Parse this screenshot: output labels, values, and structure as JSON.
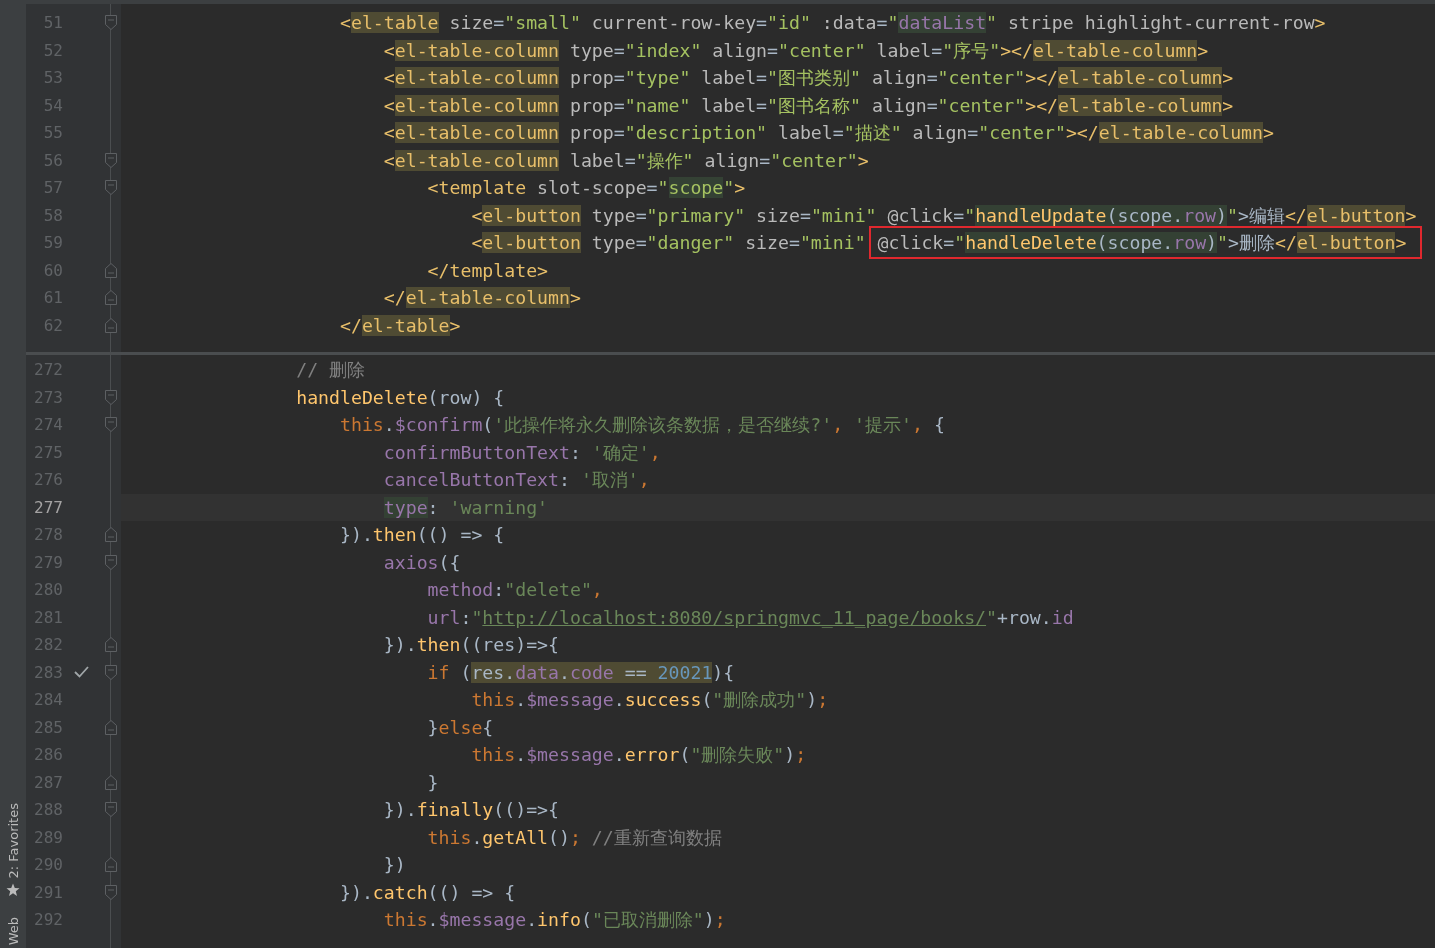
{
  "sidebar": {
    "items": [
      {
        "label": "2: Favorites",
        "kind": "starred"
      },
      {
        "label": "Web",
        "kind": "plain"
      }
    ]
  },
  "panes": [
    {
      "lines": [
        {
          "number": "51",
          "kind": "fold-start",
          "current": false,
          "check": false,
          "tokens": [
            {
              "text": "                    <",
              "kind": "tag"
            },
            {
              "text": "el-table",
              "kind": "tag_usage"
            },
            {
              "text": " size",
              "kind": "at"
            },
            {
              "text": "=",
              "kind": "p"
            },
            {
              "text": "\"small\"",
              "kind": "av"
            },
            {
              "text": " current-row-key",
              "kind": "at"
            },
            {
              "text": "=",
              "kind": "p"
            },
            {
              "text": "\"id\"",
              "kind": "av"
            },
            {
              "text": " :data",
              "kind": "at"
            },
            {
              "text": "=",
              "kind": "p"
            },
            {
              "text": "\"",
              "kind": "av"
            },
            {
              "text": "dataList",
              "kind": "pr_match"
            },
            {
              "text": "\"",
              "kind": "av"
            },
            {
              "text": " stripe highlight-current-row",
              "kind": "at"
            },
            {
              "text": ">",
              "kind": "tag"
            }
          ]
        },
        {
          "number": "52",
          "kind": "plain",
          "current": false,
          "check": false,
          "tokens": [
            {
              "text": "                        <",
              "kind": "tag"
            },
            {
              "text": "el-table-column",
              "kind": "tag_usage"
            },
            {
              "text": " type",
              "kind": "at"
            },
            {
              "text": "=",
              "kind": "p"
            },
            {
              "text": "\"index\"",
              "kind": "av"
            },
            {
              "text": " align",
              "kind": "at"
            },
            {
              "text": "=",
              "kind": "p"
            },
            {
              "text": "\"center\"",
              "kind": "av"
            },
            {
              "text": " label",
              "kind": "at"
            },
            {
              "text": "=",
              "kind": "p"
            },
            {
              "text": "\"序号\"",
              "kind": "av"
            },
            {
              "text": "></",
              "kind": "tag"
            },
            {
              "text": "el-table-column",
              "kind": "tag_usage"
            },
            {
              "text": ">",
              "kind": "tag"
            }
          ]
        },
        {
          "number": "53",
          "kind": "plain",
          "current": false,
          "check": false,
          "tokens": [
            {
              "text": "                        <",
              "kind": "tag"
            },
            {
              "text": "el-table-column",
              "kind": "tag_usage"
            },
            {
              "text": " prop",
              "kind": "at"
            },
            {
              "text": "=",
              "kind": "p"
            },
            {
              "text": "\"type\"",
              "kind": "av"
            },
            {
              "text": " label",
              "kind": "at"
            },
            {
              "text": "=",
              "kind": "p"
            },
            {
              "text": "\"图书类别\"",
              "kind": "av"
            },
            {
              "text": " align",
              "kind": "at"
            },
            {
              "text": "=",
              "kind": "p"
            },
            {
              "text": "\"center\"",
              "kind": "av"
            },
            {
              "text": "></",
              "kind": "tag"
            },
            {
              "text": "el-table-column",
              "kind": "tag_usage"
            },
            {
              "text": ">",
              "kind": "tag"
            }
          ]
        },
        {
          "number": "54",
          "kind": "plain",
          "current": false,
          "check": false,
          "tokens": [
            {
              "text": "                        <",
              "kind": "tag"
            },
            {
              "text": "el-table-column",
              "kind": "tag_usage"
            },
            {
              "text": " prop",
              "kind": "at"
            },
            {
              "text": "=",
              "kind": "p"
            },
            {
              "text": "\"name\"",
              "kind": "av"
            },
            {
              "text": " label",
              "kind": "at"
            },
            {
              "text": "=",
              "kind": "p"
            },
            {
              "text": "\"图书名称\"",
              "kind": "av"
            },
            {
              "text": " align",
              "kind": "at"
            },
            {
              "text": "=",
              "kind": "p"
            },
            {
              "text": "\"center\"",
              "kind": "av"
            },
            {
              "text": "></",
              "kind": "tag"
            },
            {
              "text": "el-table-column",
              "kind": "tag_usage"
            },
            {
              "text": ">",
              "kind": "tag"
            }
          ]
        },
        {
          "number": "55",
          "kind": "plain",
          "current": false,
          "check": false,
          "tokens": [
            {
              "text": "                        <",
              "kind": "tag"
            },
            {
              "text": "el-table-column",
              "kind": "tag_usage"
            },
            {
              "text": " prop",
              "kind": "at"
            },
            {
              "text": "=",
              "kind": "p"
            },
            {
              "text": "\"description\"",
              "kind": "av"
            },
            {
              "text": " label",
              "kind": "at"
            },
            {
              "text": "=",
              "kind": "p"
            },
            {
              "text": "\"描述\"",
              "kind": "av"
            },
            {
              "text": " align",
              "kind": "at"
            },
            {
              "text": "=",
              "kind": "p"
            },
            {
              "text": "\"center\"",
              "kind": "av"
            },
            {
              "text": "></",
              "kind": "tag"
            },
            {
              "text": "el-table-column",
              "kind": "tag_usage"
            },
            {
              "text": ">",
              "kind": "tag"
            }
          ]
        },
        {
          "number": "56",
          "kind": "fold-start",
          "current": false,
          "check": false,
          "tokens": [
            {
              "text": "                        <",
              "kind": "tag"
            },
            {
              "text": "el-table-column",
              "kind": "tag_usage"
            },
            {
              "text": " label",
              "kind": "at"
            },
            {
              "text": "=",
              "kind": "p"
            },
            {
              "text": "\"操作\"",
              "kind": "av"
            },
            {
              "text": " align",
              "kind": "at"
            },
            {
              "text": "=",
              "kind": "p"
            },
            {
              "text": "\"center\"",
              "kind": "av"
            },
            {
              "text": ">",
              "kind": "tag"
            }
          ]
        },
        {
          "number": "57",
          "kind": "fold-start",
          "current": false,
          "check": false,
          "tokens": [
            {
              "text": "                            <template",
              "kind": "tag"
            },
            {
              "text": " slot-scope",
              "kind": "at"
            },
            {
              "text": "=",
              "kind": "p"
            },
            {
              "text": "\"",
              "kind": "av"
            },
            {
              "text": "scope",
              "kind": "av_match"
            },
            {
              "text": "\"",
              "kind": "av"
            },
            {
              "text": ">",
              "kind": "tag"
            }
          ]
        },
        {
          "number": "58",
          "kind": "plain",
          "current": false,
          "check": false,
          "tokens": [
            {
              "text": "                                <",
              "kind": "tag"
            },
            {
              "text": "el-button",
              "kind": "tag_usage"
            },
            {
              "text": " type",
              "kind": "at"
            },
            {
              "text": "=",
              "kind": "p"
            },
            {
              "text": "\"primary\"",
              "kind": "av"
            },
            {
              "text": " size",
              "kind": "at"
            },
            {
              "text": "=",
              "kind": "p"
            },
            {
              "text": "\"mini\"",
              "kind": "av"
            },
            {
              "text": " @click",
              "kind": "at"
            },
            {
              "text": "=",
              "kind": "p"
            },
            {
              "text": "\"",
              "kind": "av"
            },
            {
              "text": "handleUpdate",
              "kind": "fn_match"
            },
            {
              "text": "(scope.",
              "kind": "p_match"
            },
            {
              "text": "row",
              "kind": "pr_match"
            },
            {
              "text": ")",
              "kind": "p_match"
            },
            {
              "text": "\"",
              "kind": "av"
            },
            {
              "text": ">编辑",
              "kind": "p"
            },
            {
              "text": "</",
              "kind": "tag"
            },
            {
              "text": "el-button",
              "kind": "tag_usage"
            },
            {
              "text": ">",
              "kind": "tag"
            }
          ]
        },
        {
          "number": "59",
          "kind": "plain",
          "current": false,
          "check": false,
          "tokens": [
            {
              "text": "                                <",
              "kind": "tag"
            },
            {
              "text": "el-button",
              "kind": "tag_usage"
            },
            {
              "text": " type",
              "kind": "at"
            },
            {
              "text": "=",
              "kind": "p"
            },
            {
              "text": "\"danger\"",
              "kind": "av"
            },
            {
              "text": " size",
              "kind": "at"
            },
            {
              "text": "=",
              "kind": "p"
            },
            {
              "text": "\"mini\" ",
              "kind": "av"
            }
          ],
          "framed_tokens": [
            {
              "text": "@click",
              "kind": "at"
            },
            {
              "text": "=",
              "kind": "p"
            },
            {
              "text": "\"",
              "kind": "av"
            },
            {
              "text": "handleDelete",
              "kind": "fn_match"
            },
            {
              "text": "(scope.",
              "kind": "p_match"
            },
            {
              "text": "row",
              "kind": "pr_match"
            },
            {
              "text": ")",
              "kind": "p_match"
            },
            {
              "text": "\"",
              "kind": "av"
            },
            {
              "text": ">删除",
              "kind": "p"
            },
            {
              "text": "</",
              "kind": "tag"
            },
            {
              "text": "el-button",
              "kind": "tag_usage"
            },
            {
              "text": ">",
              "kind": "tag"
            }
          ]
        },
        {
          "number": "60",
          "kind": "fold-end",
          "current": false,
          "check": false,
          "tokens": [
            {
              "text": "                            </template>",
              "kind": "tag"
            }
          ]
        },
        {
          "number": "61",
          "kind": "fold-end",
          "current": false,
          "check": false,
          "tokens": [
            {
              "text": "                        </",
              "kind": "tag"
            },
            {
              "text": "el-table-column",
              "kind": "tag_usage"
            },
            {
              "text": ">",
              "kind": "tag"
            }
          ]
        },
        {
          "number": "62",
          "kind": "fold-end",
          "current": false,
          "check": false,
          "tokens": [
            {
              "text": "                    </",
              "kind": "tag"
            },
            {
              "text": "el-table",
              "kind": "tag_usage"
            },
            {
              "text": ">",
              "kind": "tag"
            }
          ]
        }
      ]
    },
    {
      "lines": [
        {
          "number": "272",
          "kind": "plain",
          "current": false,
          "check": false,
          "tokens": [
            {
              "text": "                // 删除",
              "kind": "c"
            }
          ]
        },
        {
          "number": "273",
          "kind": "fold-start",
          "current": false,
          "check": false,
          "tokens": [
            {
              "text": "                handleDelete",
              "kind": "fn"
            },
            {
              "text": "(row) {",
              "kind": "p"
            }
          ]
        },
        {
          "number": "274",
          "kind": "fold-start",
          "current": false,
          "check": false,
          "tokens": [
            {
              "text": "                    this",
              "kind": "kw"
            },
            {
              "text": ".",
              "kind": "p"
            },
            {
              "text": "$confirm",
              "kind": "pr"
            },
            {
              "text": "(",
              "kind": "p"
            },
            {
              "text": "'此操作将永久删除该条数据，是否继续?'",
              "kind": "s"
            },
            {
              "text": ", ",
              "kind": "kw"
            },
            {
              "text": "'提示'",
              "kind": "s"
            },
            {
              "text": ", ",
              "kind": "kw"
            },
            {
              "text": "{",
              "kind": "p"
            }
          ]
        },
        {
          "number": "275",
          "kind": "plain",
          "current": false,
          "check": false,
          "tokens": [
            {
              "text": "                        confirmButtonText",
              "kind": "pr"
            },
            {
              "text": ": ",
              "kind": "p"
            },
            {
              "text": "'确定'",
              "kind": "s"
            },
            {
              "text": ",",
              "kind": "kw"
            }
          ]
        },
        {
          "number": "276",
          "kind": "plain",
          "current": false,
          "check": false,
          "tokens": [
            {
              "text": "                        cancelButtonText",
              "kind": "pr"
            },
            {
              "text": ": ",
              "kind": "p"
            },
            {
              "text": "'取消'",
              "kind": "s"
            },
            {
              "text": ",",
              "kind": "kw"
            }
          ]
        },
        {
          "number": "277",
          "kind": "plain",
          "current": true,
          "check": false,
          "tokens": [
            {
              "text": "                        type",
              "kind": "pr_match"
            },
            {
              "text": ": ",
              "kind": "p"
            },
            {
              "text": "'warning'",
              "kind": "s"
            }
          ]
        },
        {
          "number": "278",
          "kind": "fold-end",
          "current": false,
          "check": false,
          "tokens": [
            {
              "text": "                    }).",
              "kind": "p"
            },
            {
              "text": "then",
              "kind": "fn"
            },
            {
              "text": "(() => {",
              "kind": "p"
            }
          ]
        },
        {
          "number": "279",
          "kind": "fold-start",
          "current": false,
          "check": false,
          "tokens": [
            {
              "text": "                        axios",
              "kind": "pr"
            },
            {
              "text": "({",
              "kind": "p"
            }
          ]
        },
        {
          "number": "280",
          "kind": "plain",
          "current": false,
          "check": false,
          "tokens": [
            {
              "text": "                            method",
              "kind": "pr"
            },
            {
              "text": ":",
              "kind": "p"
            },
            {
              "text": "\"delete\"",
              "kind": "s"
            },
            {
              "text": ",",
              "kind": "kw"
            }
          ]
        },
        {
          "number": "281",
          "kind": "plain",
          "current": false,
          "check": false,
          "tokens": [
            {
              "text": "                            url",
              "kind": "pr"
            },
            {
              "text": ":",
              "kind": "p"
            },
            {
              "text": "\"",
              "kind": "s"
            },
            {
              "text": "http://localhost:8080/springmvc_11_page/books/",
              "kind": "u"
            },
            {
              "text": "\"",
              "kind": "s"
            },
            {
              "text": "+row.",
              "kind": "p"
            },
            {
              "text": "id",
              "kind": "pr"
            }
          ]
        },
        {
          "number": "282",
          "kind": "fold-end",
          "current": false,
          "check": false,
          "tokens": [
            {
              "text": "                        }).",
              "kind": "p"
            },
            {
              "text": "then",
              "kind": "fn"
            },
            {
              "text": "((res)=>{",
              "kind": "p"
            }
          ]
        },
        {
          "number": "283",
          "kind": "fold-start",
          "current": false,
          "check": true,
          "tokens": [
            {
              "text": "                            if",
              "kind": "kw"
            },
            {
              "text": " (",
              "kind": "p"
            },
            {
              "text": "res.",
              "kind": "p_usage"
            },
            {
              "text": "data",
              "kind": "pr_usage"
            },
            {
              "text": ".",
              "kind": "p_usage"
            },
            {
              "text": "code",
              "kind": "pr_usage"
            },
            {
              "text": " == ",
              "kind": "p_usage"
            },
            {
              "text": "20021",
              "kind": "n_usage"
            },
            {
              "text": "){",
              "kind": "p"
            }
          ]
        },
        {
          "number": "284",
          "kind": "plain",
          "current": false,
          "check": false,
          "tokens": [
            {
              "text": "                                this",
              "kind": "kw"
            },
            {
              "text": ".",
              "kind": "p"
            },
            {
              "text": "$message",
              "kind": "pr"
            },
            {
              "text": ".",
              "kind": "p"
            },
            {
              "text": "success",
              "kind": "fn"
            },
            {
              "text": "(",
              "kind": "p"
            },
            {
              "text": "\"删除成功\"",
              "kind": "s"
            },
            {
              "text": ")",
              "kind": "p"
            },
            {
              "text": ";",
              "kind": "kw"
            }
          ]
        },
        {
          "number": "285",
          "kind": "fold-end",
          "current": false,
          "check": false,
          "tokens": [
            {
              "text": "                            }",
              "kind": "p"
            },
            {
              "text": "else",
              "kind": "kw"
            },
            {
              "text": "{",
              "kind": "p"
            }
          ]
        },
        {
          "number": "286",
          "kind": "plain",
          "current": false,
          "check": false,
          "tokens": [
            {
              "text": "                                this",
              "kind": "kw"
            },
            {
              "text": ".",
              "kind": "p"
            },
            {
              "text": "$message",
              "kind": "pr"
            },
            {
              "text": ".",
              "kind": "p"
            },
            {
              "text": "error",
              "kind": "fn"
            },
            {
              "text": "(",
              "kind": "p"
            },
            {
              "text": "\"删除失败\"",
              "kind": "s"
            },
            {
              "text": ")",
              "kind": "p"
            },
            {
              "text": ";",
              "kind": "kw"
            }
          ]
        },
        {
          "number": "287",
          "kind": "fold-end",
          "current": false,
          "check": false,
          "tokens": [
            {
              "text": "                            }",
              "kind": "p"
            }
          ]
        },
        {
          "number": "288",
          "kind": "fold-start",
          "current": false,
          "check": false,
          "tokens": [
            {
              "text": "                        }).",
              "kind": "p"
            },
            {
              "text": "finally",
              "kind": "fn"
            },
            {
              "text": "(()=>{",
              "kind": "p"
            }
          ]
        },
        {
          "number": "289",
          "kind": "plain",
          "current": false,
          "check": false,
          "tokens": [
            {
              "text": "                            this",
              "kind": "kw"
            },
            {
              "text": ".",
              "kind": "p"
            },
            {
              "text": "getAll",
              "kind": "fn"
            },
            {
              "text": "()",
              "kind": "p"
            },
            {
              "text": ";",
              "kind": "kw"
            },
            {
              "text": " //重新查询数据",
              "kind": "c"
            }
          ]
        },
        {
          "number": "290",
          "kind": "fold-end",
          "current": false,
          "check": false,
          "tokens": [
            {
              "text": "                        })",
              "kind": "p"
            }
          ]
        },
        {
          "number": "291",
          "kind": "fold-start",
          "current": false,
          "check": false,
          "tokens": [
            {
              "text": "                    }).",
              "kind": "p"
            },
            {
              "text": "catch",
              "kind": "fn"
            },
            {
              "text": "(() => {",
              "kind": "p"
            }
          ]
        },
        {
          "number": "292",
          "kind": "plain",
          "current": false,
          "check": false,
          "tokens": [
            {
              "text": "                        this",
              "kind": "kw"
            },
            {
              "text": ".",
              "kind": "p"
            },
            {
              "text": "$message",
              "kind": "pr"
            },
            {
              "text": ".",
              "kind": "p"
            },
            {
              "text": "info",
              "kind": "fn"
            },
            {
              "text": "(",
              "kind": "p"
            },
            {
              "text": "\"已取消删除\"",
              "kind": "s"
            },
            {
              "text": ")",
              "kind": "p"
            },
            {
              "text": ";",
              "kind": "kw"
            }
          ]
        }
      ]
    }
  ]
}
